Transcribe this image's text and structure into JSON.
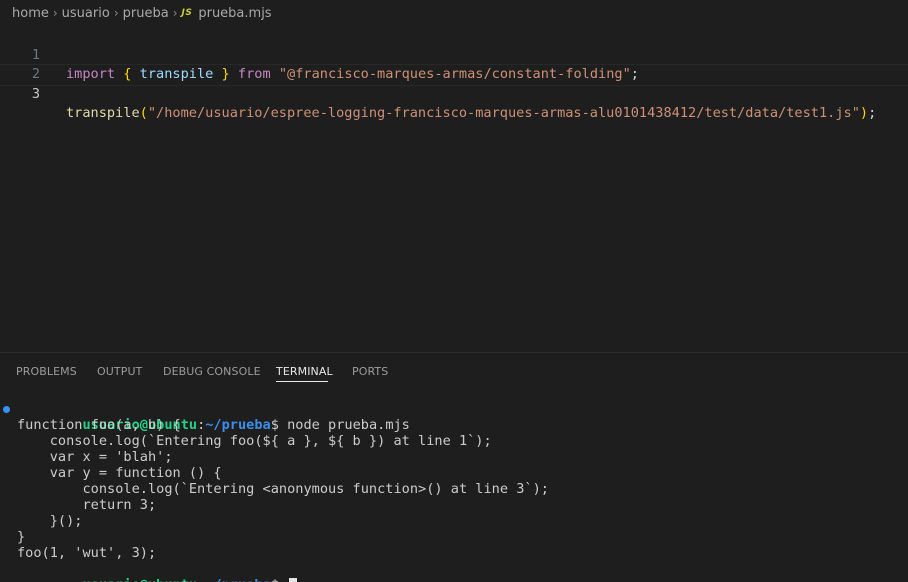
{
  "breadcrumb": {
    "items": [
      "home",
      "usuario",
      "prueba"
    ],
    "file_icon": "JS",
    "file_name": "prueba.mjs"
  },
  "editor": {
    "line_numbers": [
      "1",
      "2",
      "3"
    ],
    "line1": {
      "import": "import",
      "brace_open": "{",
      "ident": "transpile",
      "brace_close": "}",
      "from": "from",
      "module": "\"@francisco-marques-armas/constant-folding\"",
      "semi": ";"
    },
    "line3": {
      "fn": "transpile",
      "paren_open": "(",
      "arg": "\"/home/usuario/espree-logging-francisco-marques-armas-alu0101438412/test/data/test1.js\"",
      "paren_close": ")",
      "semi": ";"
    }
  },
  "panel": {
    "tabs": [
      "PROBLEMS",
      "OUTPUT",
      "DEBUG CONSOLE",
      "TERMINAL",
      "PORTS"
    ],
    "active_tab": "TERMINAL"
  },
  "terminal": {
    "prompt_user": "usuario@ubuntu",
    "prompt_sep": ":",
    "prompt_path": "~/prueba",
    "prompt_end": "$ ",
    "command": "node prueba.mjs",
    "output": [
      "function foo(a, b) {",
      "    console.log(`Entering foo(${ a }, ${ b }) at line 1`);",
      "    var x = 'blah';",
      "    var y = function () {",
      "        console.log(`Entering <anonymous function>() at line 3`);",
      "        return 3;",
      "    }();",
      "}",
      "foo(1, 'wut', 3);"
    ]
  },
  "colors": {
    "background": "#1e1e1e",
    "prompt_user": "#23d18b",
    "prompt_path": "#3b8eea",
    "keyword": "#c586c0",
    "identifier": "#9cdcfe",
    "function": "#dcdcaa",
    "string": "#ce9178"
  }
}
